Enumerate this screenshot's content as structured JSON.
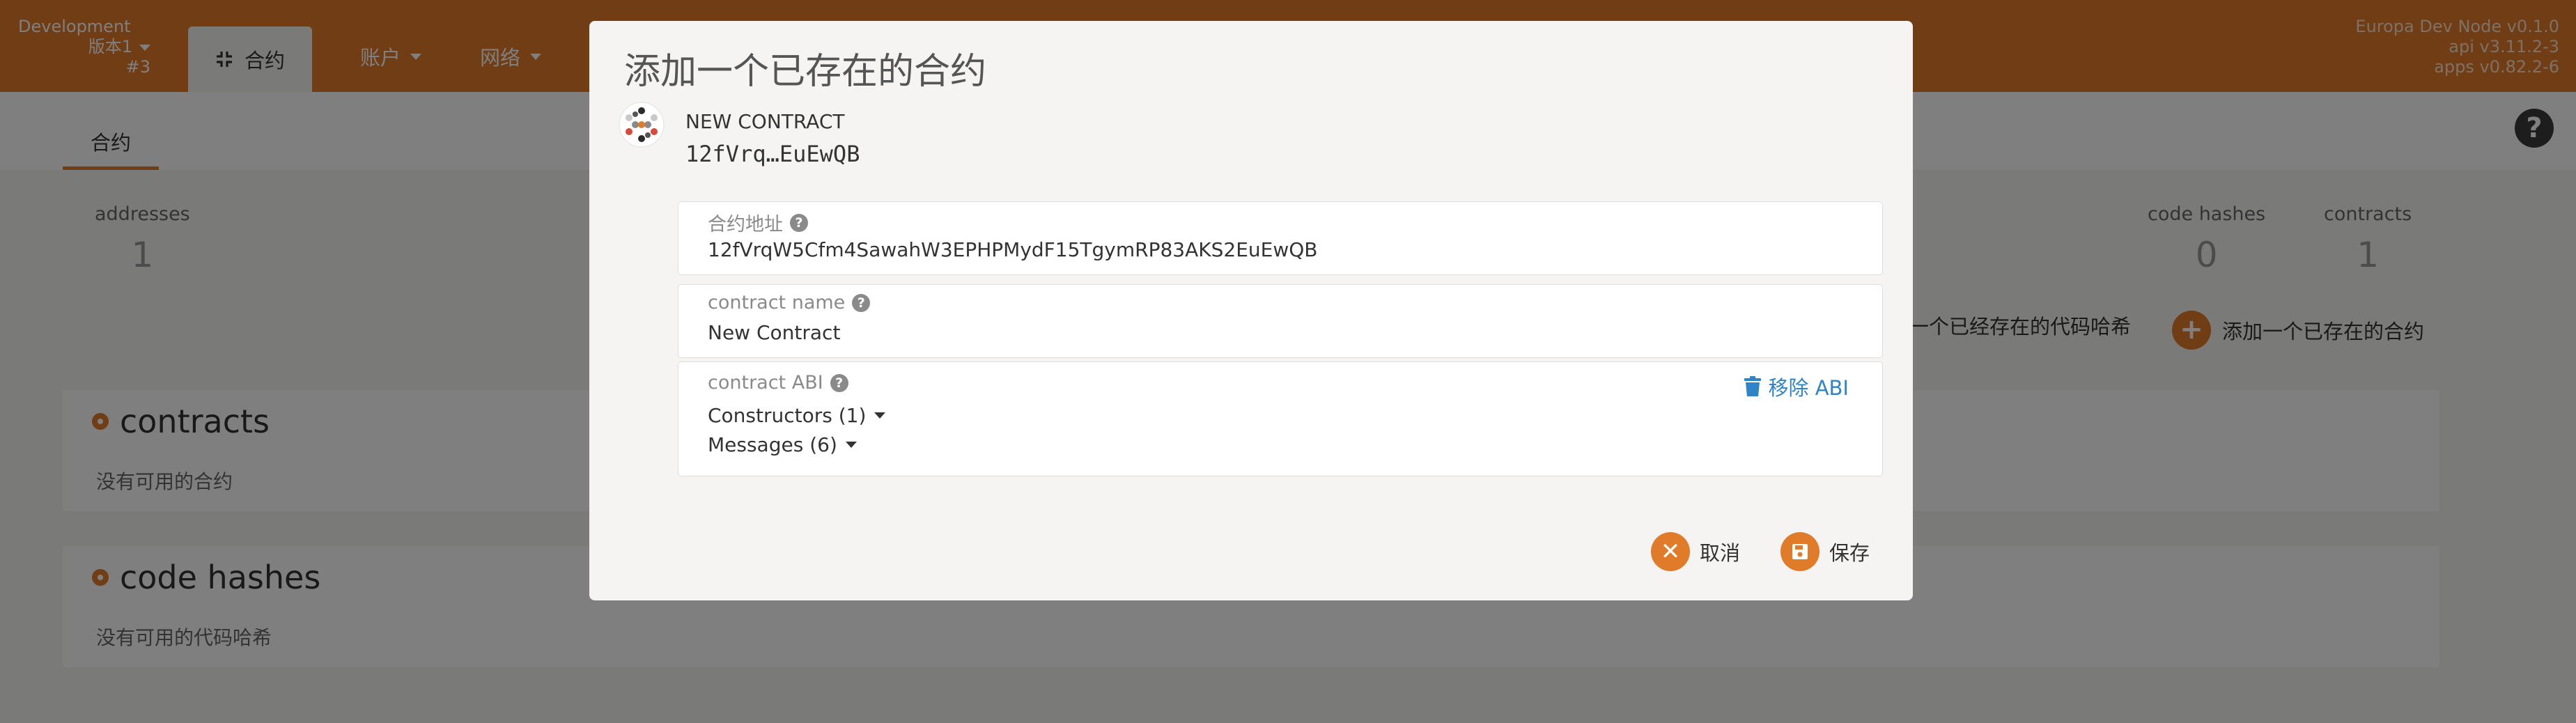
{
  "header": {
    "chain_name": "Development",
    "version_label": "版本1",
    "block_number": "#3",
    "active_tab_label": "合约",
    "nav_items": [
      {
        "label": "账户"
      },
      {
        "label": "网络"
      }
    ],
    "node_info": {
      "name": "Europa Dev Node v0.1.0",
      "api": "api v3.11.2-3",
      "apps": "apps v0.82.2-6"
    }
  },
  "subnav": {
    "tab_label": "合约",
    "help_glyph": "?"
  },
  "summary": {
    "addresses_label": "addresses",
    "addresses_value": "1",
    "code_hashes_label": "code hashes",
    "code_hashes_value": "0",
    "contracts_label": "contracts",
    "contracts_value": "1"
  },
  "actions": {
    "add_code_hash_label": "一个已经存在的代码哈希",
    "add_contract_label": "添加一个已存在的合约",
    "add_glyph": "+"
  },
  "sections": {
    "contracts_title": "contracts",
    "contracts_empty": "没有可用的合约",
    "code_hashes_title": "code hashes",
    "code_hashes_empty": "没有可用的代码哈希"
  },
  "modal": {
    "title": "添加一个已存在的合约",
    "contract_name": "NEW CONTRACT",
    "contract_address_short": "12fVrq…EuEwQB",
    "address_field": {
      "label": "合约地址",
      "value": "12fVrqW5Cfm4SawahW3EPHPMydF15TgymRP83AKS2EuEwQB"
    },
    "name_field": {
      "label": "contract name",
      "value": "New Contract"
    },
    "abi_field": {
      "label": "contract ABI",
      "constructors_label": "Constructors (1)",
      "messages_label": "Messages (6)",
      "remove_label": "移除 ABI"
    },
    "help_glyph": "?",
    "cancel_label": "取消",
    "save_label": "保存",
    "cancel_glyph": "✕"
  },
  "colors": {
    "brand": "#e07b2a",
    "link": "#2f84c8"
  }
}
